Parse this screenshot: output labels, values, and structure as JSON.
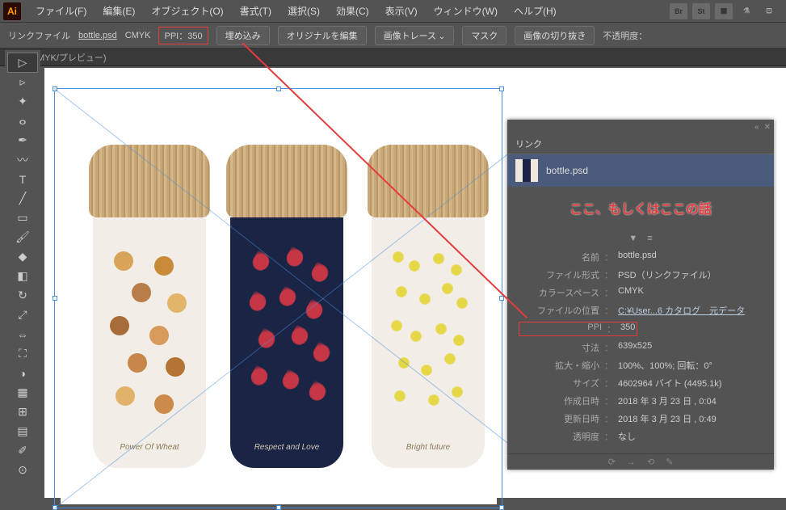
{
  "menubar": {
    "items": [
      "ファイル(F)",
      "編集(E)",
      "オブジェクト(O)",
      "書式(T)",
      "選択(S)",
      "効果(C)",
      "表示(V)",
      "ウィンドウ(W)",
      "ヘルプ(H)"
    ]
  },
  "topright": {
    "br": "Br",
    "st": "St"
  },
  "optbar": {
    "linkfile": "リンクファイル",
    "filename": "bottle.psd",
    "colormode": "CMYK",
    "ppi": "PPI：350",
    "embed": "埋め込み",
    "editorig": "オリジナルを編集",
    "trace": "画像トレース",
    "mask": "マスク",
    "crop": "画像の切り抜き",
    "opacity": "不透明度："
  },
  "tabbar": {
    "doc": "MYK/プレビュー)"
  },
  "bottles": {
    "label1": "Power Of Wheat",
    "label2": "Respect and Love",
    "label3": "Bright future"
  },
  "panel": {
    "tab": "リンク",
    "item": "bottle.psd",
    "annotation": "ここ、もしくはここの話",
    "info": {
      "name_l": "名前",
      "name_v": "bottle.psd",
      "fmt_l": "ファイル形式",
      "fmt_v": "PSD（リンクファイル）",
      "cs_l": "カラースペース",
      "cs_v": "CMYK",
      "loc_l": "ファイルの位置",
      "loc_v": "C:¥User...6 カタログ　元データ",
      "ppi_l": "PPI",
      "ppi_v": "350",
      "dim_l": "寸法",
      "dim_v": "639x525",
      "scale_l": "拡大・縮小",
      "scale_v": "100%、100%; 回転：0°",
      "size_l": "サイズ",
      "size_v": "4602964 バイト (4495.1k)",
      "cdate_l": "作成日時",
      "cdate_v": "2018 年 3 月 23 日 , 0:04",
      "mdate_l": "更新日時",
      "mdate_v": "2018 年 3 月 23 日 , 0:49",
      "trans_l": "透明度",
      "trans_v": "なし"
    }
  }
}
